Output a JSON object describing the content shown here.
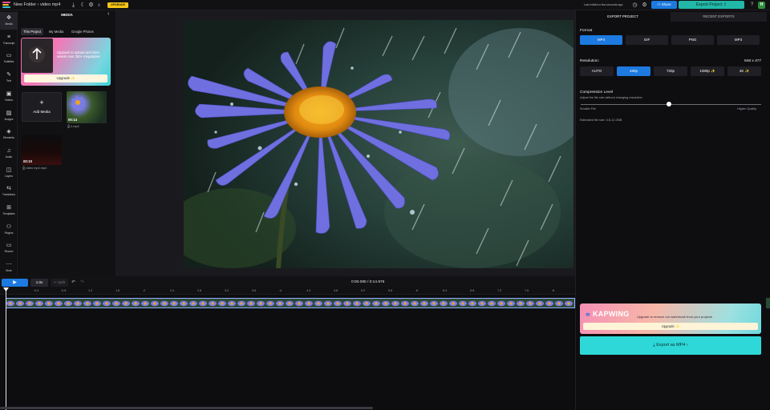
{
  "header": {
    "folder": "New Folder",
    "separator": "›",
    "project_name": "video mp4",
    "upgrade_label": "UPGRADE",
    "last_edited": "Last edited a few seconds ago",
    "share_label": "Share",
    "export_label": "Export Project",
    "avatar_initial": "H"
  },
  "nav": [
    {
      "label": "Media",
      "icon": "media-icon",
      "glyph": "✥"
    },
    {
      "label": "Transcript",
      "icon": "transcript-icon",
      "glyph": "≡"
    },
    {
      "label": "Subtitles",
      "icon": "subtitles-icon",
      "glyph": "▭"
    },
    {
      "label": "Text",
      "icon": "text-icon",
      "glyph": "✎"
    },
    {
      "label": "Videos",
      "icon": "videos-icon",
      "glyph": "▣"
    },
    {
      "label": "Images",
      "icon": "images-icon",
      "glyph": "▨"
    },
    {
      "label": "Elements",
      "icon": "elements-icon",
      "glyph": "◈"
    },
    {
      "label": "Audio",
      "icon": "audio-icon",
      "glyph": "♫"
    },
    {
      "label": "Layers",
      "icon": "layers-icon",
      "glyph": "◫"
    },
    {
      "label": "Transitions",
      "icon": "transitions-icon",
      "glyph": "⇆"
    },
    {
      "label": "Templates",
      "icon": "templates-icon",
      "glyph": "⊞"
    },
    {
      "label": "Plugins",
      "icon": "plugins-icon",
      "glyph": "⚇"
    },
    {
      "label": "Record",
      "icon": "record-icon",
      "glyph": "▭"
    },
    {
      "label": "More",
      "icon": "more-icon",
      "glyph": "⋯"
    }
  ],
  "media": {
    "title": "MEDIA",
    "tabs": [
      "This Project",
      "My Media",
      "Google Photos"
    ],
    "upgrade_text": "Upgrade to upload and store assets over 250+ megabytes",
    "upgrade_button": "Upgrade ✨",
    "add_media": "Add Media",
    "items": [
      {
        "duration": "00:14",
        "name": "2.mp4"
      },
      {
        "duration": "00:10",
        "name": "video mp4.mp4"
      }
    ]
  },
  "export": {
    "tabs": [
      "EXPORT PROJECT",
      "RECENT EXPORTS"
    ],
    "format_label": "Format",
    "formats": [
      "MP4",
      "GIF",
      "PNG",
      "MP3"
    ],
    "selected_format": "MP4",
    "resolution_label": "Resolution:",
    "resolution_value": "848 x 477",
    "resolutions": [
      "AUTO",
      "480p",
      "720p",
      "1080p ✨",
      "4K ✨"
    ],
    "selected_resolution": "480p",
    "compression_label": "Compression Level",
    "compression_sub": "Adjust the file size without changing resolution",
    "compression_level": 0.49,
    "smaller": "Smaller File",
    "higher": "Higher Quality",
    "file_size": "Estimated file size: 4.8-12.2MB",
    "watermark_brand": "KAPWING",
    "watermark_text": "Upgrade to remove our watermark from your projects",
    "watermark_button": "Upgrade ✨",
    "export_button": "Export as MP4 ›"
  },
  "playback": {
    "play": "▶",
    "speed": "1.0x",
    "split": "✂ Split",
    "undo": "↶",
    "redo": "↷",
    "time": "0:00.080 / 0:14.976"
  },
  "ruler": [
    ":0.4",
    ":0.8",
    "1.2",
    "1.6",
    ":2",
    "2.4",
    "2.8",
    "3.2",
    "3.6",
    ":4",
    "4.4",
    "4.8",
    "5.2",
    "5.6",
    ":6",
    "6.4",
    "6.8",
    "7.2",
    "7.6",
    ":8"
  ]
}
